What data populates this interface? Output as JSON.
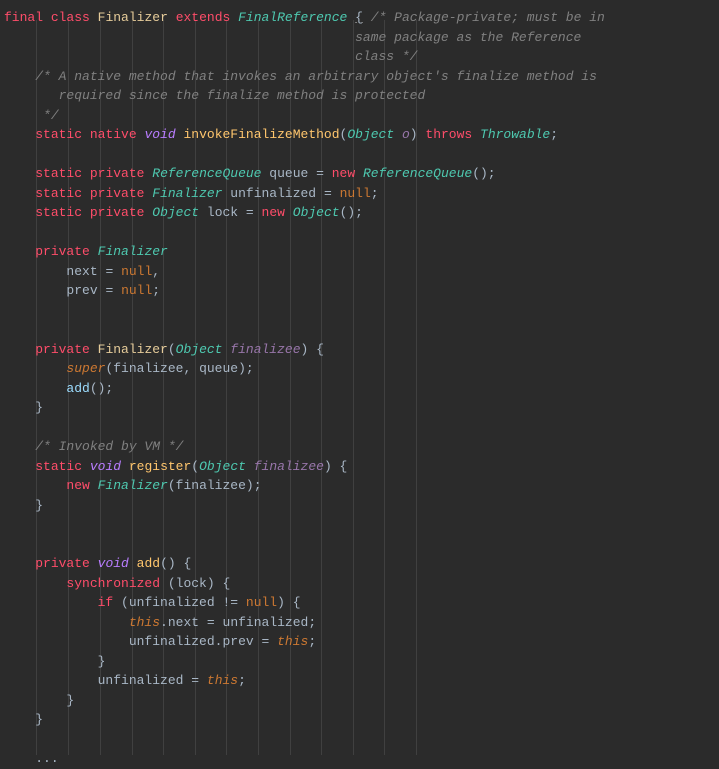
{
  "code": {
    "l0": {
      "final": "final",
      "class": "class",
      "clsname": "Finalizer",
      "extends": "extends",
      "parent": "FinalReference",
      "brace": "{",
      "comment1": "/* Package-private; must be in"
    },
    "l1": {
      "comment": "same package as the Reference"
    },
    "l2": {
      "comment": "class */"
    },
    "l3": {
      "comment": "/* A native method that invokes an arbitrary object's finalize method is"
    },
    "l4": {
      "comment": "required since the finalize method is protected"
    },
    "l5": {
      "comment": "*/"
    },
    "l6": {
      "static": "static",
      "native": "native",
      "void": "void",
      "method": "invokeFinalizeMethod",
      "type": "Object",
      "param": "o",
      "throws": "throws",
      "exc": "Throwable"
    },
    "l8": {
      "static": "static",
      "private": "private",
      "type": "ReferenceQueue",
      "name": "queue",
      "eq": "=",
      "new": "new",
      "ctor": "ReferenceQueue"
    },
    "l9": {
      "static": "static",
      "private": "private",
      "type": "Finalizer",
      "name": "unfinalized",
      "eq": "=",
      "null": "null"
    },
    "l10": {
      "static": "static",
      "private": "private",
      "type": "Object",
      "name": "lock",
      "eq": "=",
      "new": "new",
      "ctor": "Object"
    },
    "l12": {
      "private": "private",
      "type": "Finalizer"
    },
    "l13": {
      "name": "next",
      "eq": "=",
      "null": "null"
    },
    "l14": {
      "name": "prev",
      "eq": "=",
      "null": "null"
    },
    "l17": {
      "private": "private",
      "ctor": "Finalizer",
      "type": "Object",
      "param": "finalizee"
    },
    "l18": {
      "super": "super",
      "arg1": "finalizee",
      "arg2": "queue"
    },
    "l19": {
      "call": "add"
    },
    "l20": {
      "brace": "}"
    },
    "l22": {
      "comment": "/* Invoked by VM */"
    },
    "l23": {
      "static": "static",
      "void": "void",
      "method": "register",
      "type": "Object",
      "param": "finalizee"
    },
    "l24": {
      "new": "new",
      "ctor": "Finalizer",
      "arg": "finalizee"
    },
    "l25": {
      "brace": "}"
    },
    "l28": {
      "private": "private",
      "void": "void",
      "method": "add"
    },
    "l29": {
      "sync": "synchronized",
      "arg": "lock"
    },
    "l30": {
      "if": "if",
      "var": "unfinalized",
      "op": "!=",
      "null": "null"
    },
    "l31": {
      "this": "this",
      "field": "next",
      "eq": "=",
      "rhs": "unfinalized"
    },
    "l32": {
      "lhs": "unfinalized",
      "field": "prev",
      "eq": "=",
      "this": "this"
    },
    "l33": {
      "brace": "}"
    },
    "l34": {
      "lhs": "unfinalized",
      "eq": "=",
      "this": "this"
    },
    "l35": {
      "brace": "}"
    },
    "l36": {
      "brace": "}"
    },
    "l38": {
      "dots": "..."
    }
  }
}
